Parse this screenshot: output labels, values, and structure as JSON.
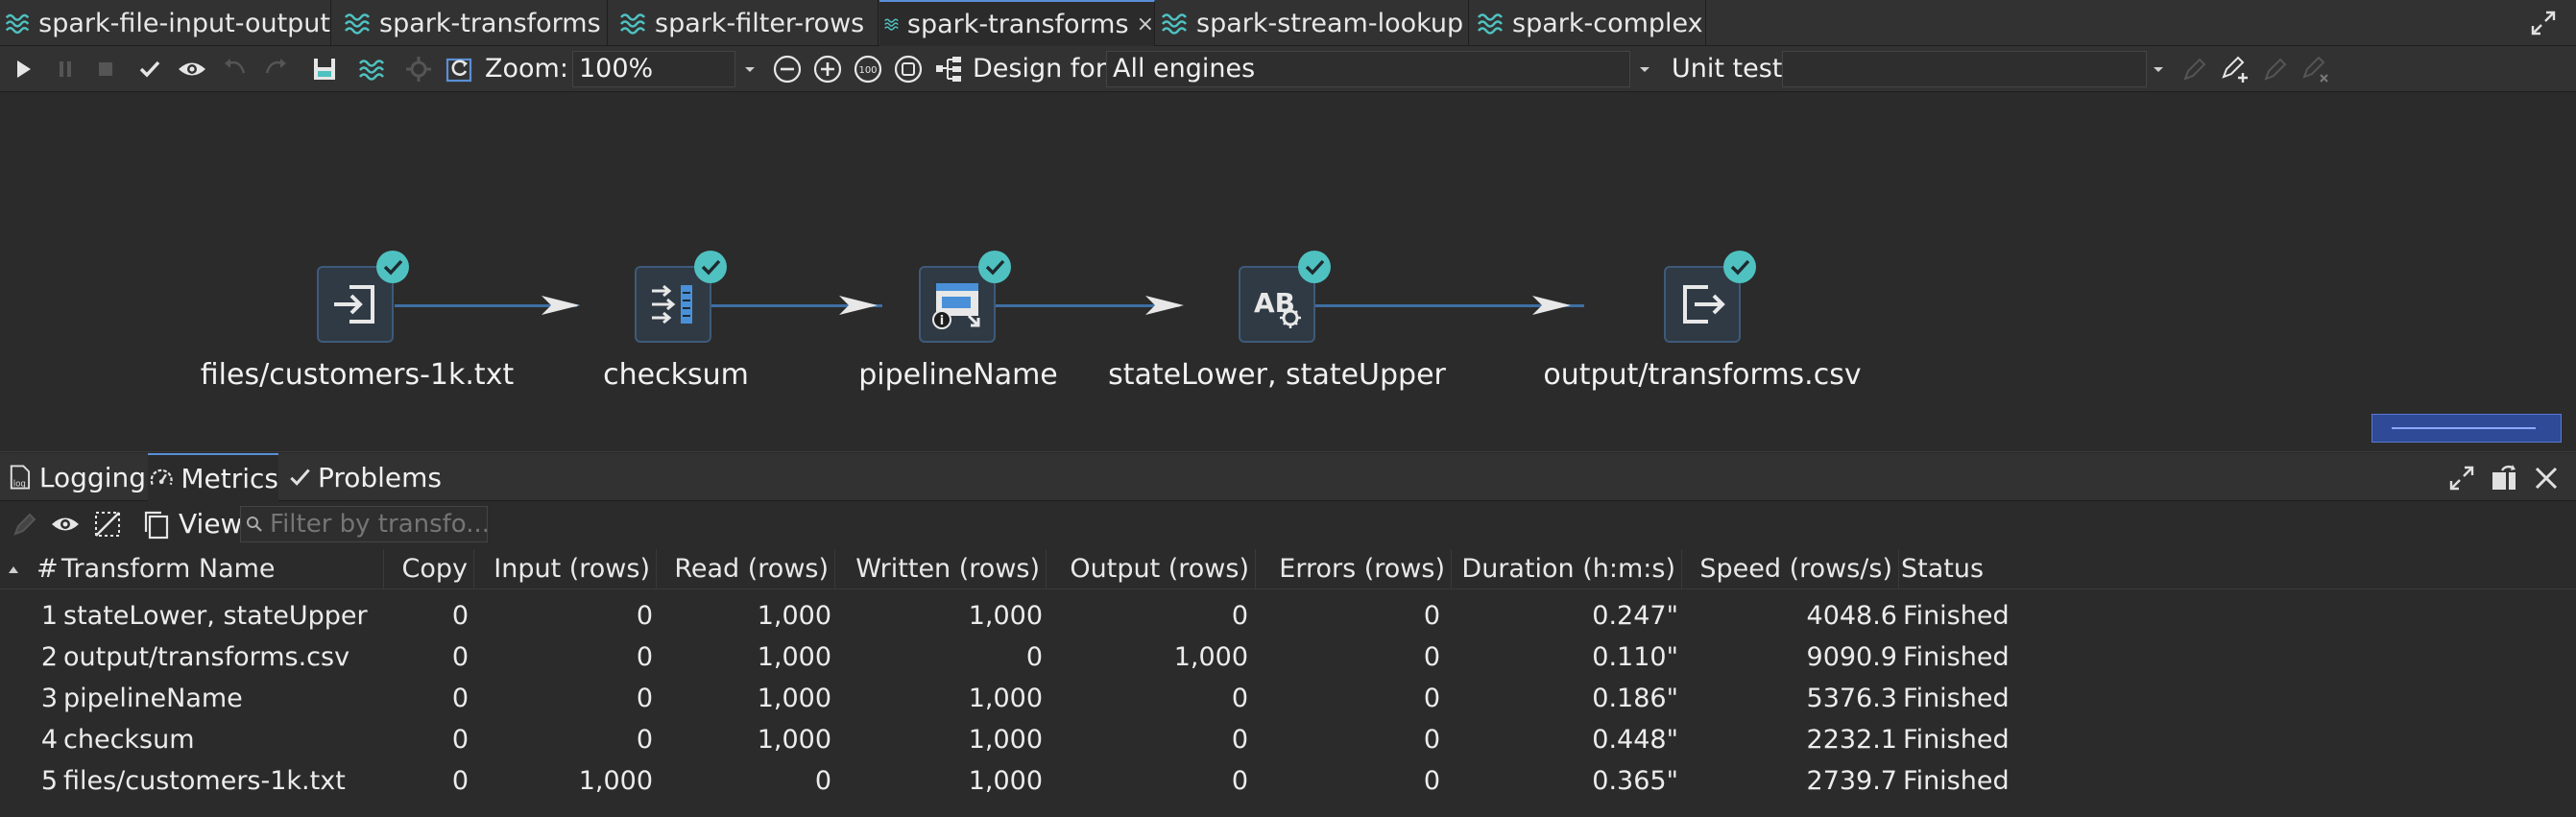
{
  "tabs": [
    {
      "label": "spark-file-input-output"
    },
    {
      "label": "spark-transforms"
    },
    {
      "label": "spark-filter-rows"
    },
    {
      "label": "spark-transforms",
      "close": "×"
    },
    {
      "label": "spark-stream-lookup"
    },
    {
      "label": "spark-complex"
    }
  ],
  "toolbar": {
    "zoom_label": "Zoom:",
    "zoom_value": "100%",
    "design_label": "Design for:",
    "design_value": "All engines",
    "unit_test_label": "Unit test:",
    "unit_test_value": ""
  },
  "pipeline": {
    "nodes": [
      {
        "label": "files/customers-1k.txt",
        "icon": "file-input-icon"
      },
      {
        "label": "checksum",
        "icon": "checksum-icon"
      },
      {
        "label": "pipelineName",
        "icon": "pipeline-info-icon"
      },
      {
        "label": "stateLower, stateUpper",
        "icon": "string-operations-icon"
      },
      {
        "label": "output/transforms.csv",
        "icon": "file-output-icon"
      }
    ]
  },
  "bottom_tabs": [
    {
      "label": "Logging"
    },
    {
      "label": "Metrics"
    },
    {
      "label": "Problems"
    }
  ],
  "metrics_toolbar": {
    "view_label": "View",
    "filter_placeholder": "Filter by transfo..."
  },
  "table": {
    "headers": [
      "#",
      "Transform Name",
      "Copy",
      "Input (rows)",
      "Read (rows)",
      "Written (rows)",
      "Output (rows)",
      "Errors (rows)",
      "Duration (h:m:s)",
      "Speed (rows/s)",
      "Status"
    ],
    "rows": [
      [
        "1",
        "stateLower, stateUpper",
        "0",
        "0",
        "1,000",
        "1,000",
        "0",
        "0",
        "0.247\"",
        "4048.6",
        "Finished"
      ],
      [
        "2",
        "output/transforms.csv",
        "0",
        "0",
        "1,000",
        "0",
        "1,000",
        "0",
        "0.110\"",
        "9090.9",
        "Finished"
      ],
      [
        "3",
        "pipelineName",
        "0",
        "0",
        "1,000",
        "1,000",
        "0",
        "0",
        "0.186\"",
        "5376.3",
        "Finished"
      ],
      [
        "4",
        "checksum",
        "0",
        "0",
        "1,000",
        "1,000",
        "0",
        "0",
        "0.448\"",
        "2232.1",
        "Finished"
      ],
      [
        "5",
        "files/customers-1k.txt",
        "0",
        "1,000",
        "0",
        "1,000",
        "0",
        "0",
        "0.365\"",
        "2739.7",
        "Finished"
      ]
    ]
  },
  "colors": {
    "accent": "#4fc1c0",
    "hop": "#3f6ea3",
    "background": "#2b2b2b"
  }
}
